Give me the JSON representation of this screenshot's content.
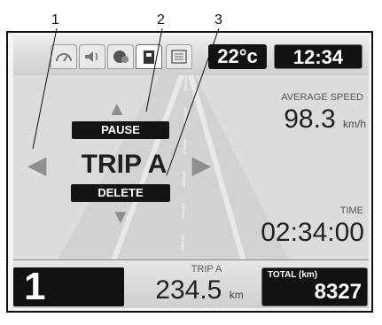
{
  "callouts": [
    "1",
    "2",
    "3"
  ],
  "status": {
    "temperature": "22°c",
    "clock": "12:34"
  },
  "tabs": [
    "speedometer-icon",
    "speaker-icon",
    "phone-icon",
    "trip-icon",
    "menu-list-icon"
  ],
  "trip": {
    "pause_label": "PAUSE",
    "title": "TRIP A",
    "delete_label": "DELETE"
  },
  "average_speed": {
    "label": "AVERAGE SPEED",
    "value": "98.3",
    "unit": "km/h"
  },
  "time": {
    "label": "TIME",
    "value": "02:34:00"
  },
  "bottom": {
    "gear": "1",
    "trip_label": "TRIP A",
    "trip_value": "234.5",
    "trip_unit": "km",
    "total_label": "TOTAL (km)",
    "total_value": "8327"
  }
}
